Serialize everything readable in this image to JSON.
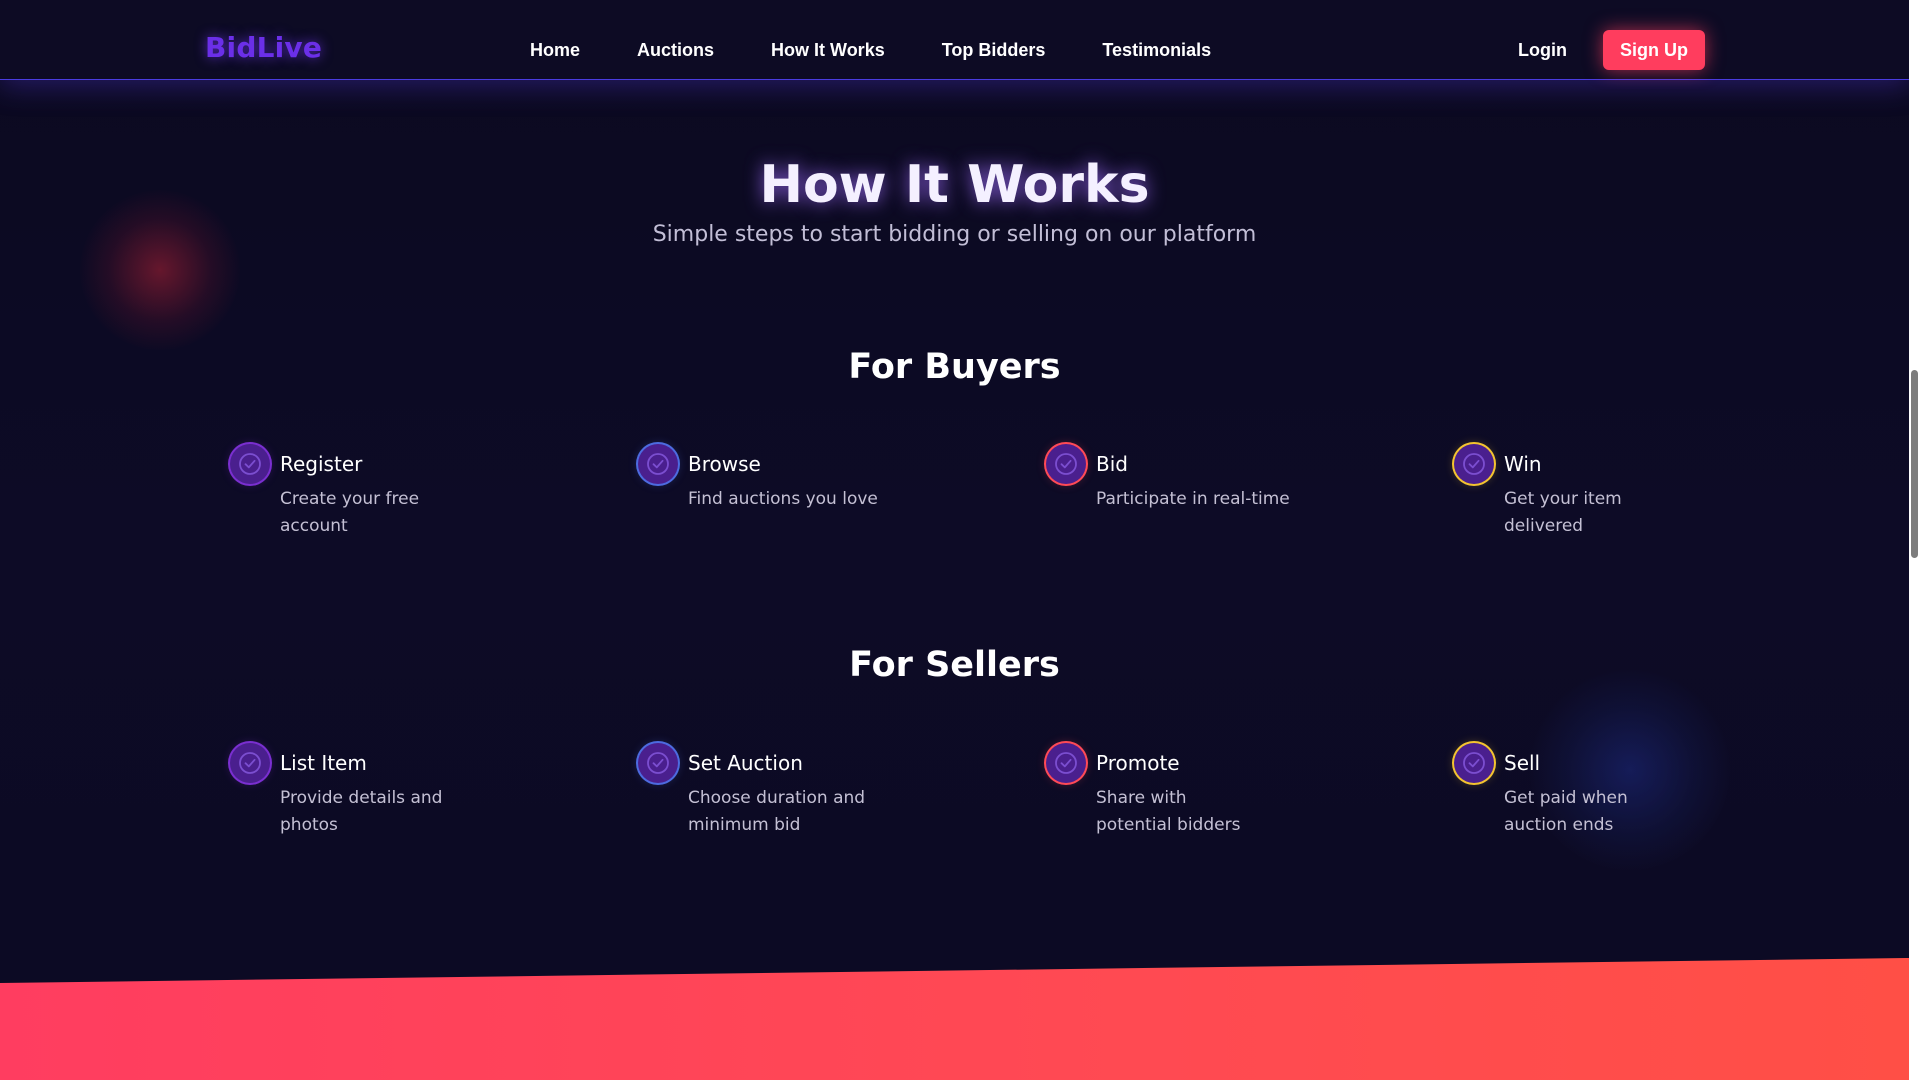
{
  "nav": {
    "logo": "BidLive",
    "links": [
      "Home",
      "Auctions",
      "How It Works",
      "Top Bidders",
      "Testimonials"
    ],
    "login": "Login",
    "signup": "Sign Up"
  },
  "section": {
    "title": "How It Works",
    "subtitle": "Simple steps to start bidding or selling on our platform"
  },
  "buyers": {
    "title": "For Buyers",
    "steps": [
      {
        "title": "Register",
        "desc": "Create your free account",
        "icon": "check-circle-icon",
        "ring": "#7a2fd0"
      },
      {
        "title": "Browse",
        "desc": "Find auctions you love",
        "icon": "check-circle-icon",
        "ring": "#4d6be0"
      },
      {
        "title": "Bid",
        "desc": "Participate in real-time",
        "icon": "check-circle-icon",
        "ring": "#ff4a57"
      },
      {
        "title": "Win",
        "desc": "Get your item delivered",
        "icon": "check-circle-icon",
        "ring": "#f4c430"
      }
    ]
  },
  "sellers": {
    "title": "For Sellers",
    "steps": [
      {
        "title": "List Item",
        "desc": "Provide details and photos",
        "icon": "check-circle-icon",
        "ring": "#7a2fd0"
      },
      {
        "title": "Set Auction",
        "desc": "Choose duration and minimum bid",
        "icon": "check-circle-icon",
        "ring": "#4d6be0"
      },
      {
        "title": "Promote",
        "desc": "Share with potential bidders",
        "icon": "check-circle-icon",
        "ring": "#ff4a57"
      },
      {
        "title": "Sell",
        "desc": "Get paid when auction ends",
        "icon": "check-circle-icon",
        "ring": "#f4c430"
      }
    ]
  },
  "colors": {
    "accent": "#ff3d5e",
    "brand": "#6b2fe8",
    "background": "#0c0a22"
  }
}
